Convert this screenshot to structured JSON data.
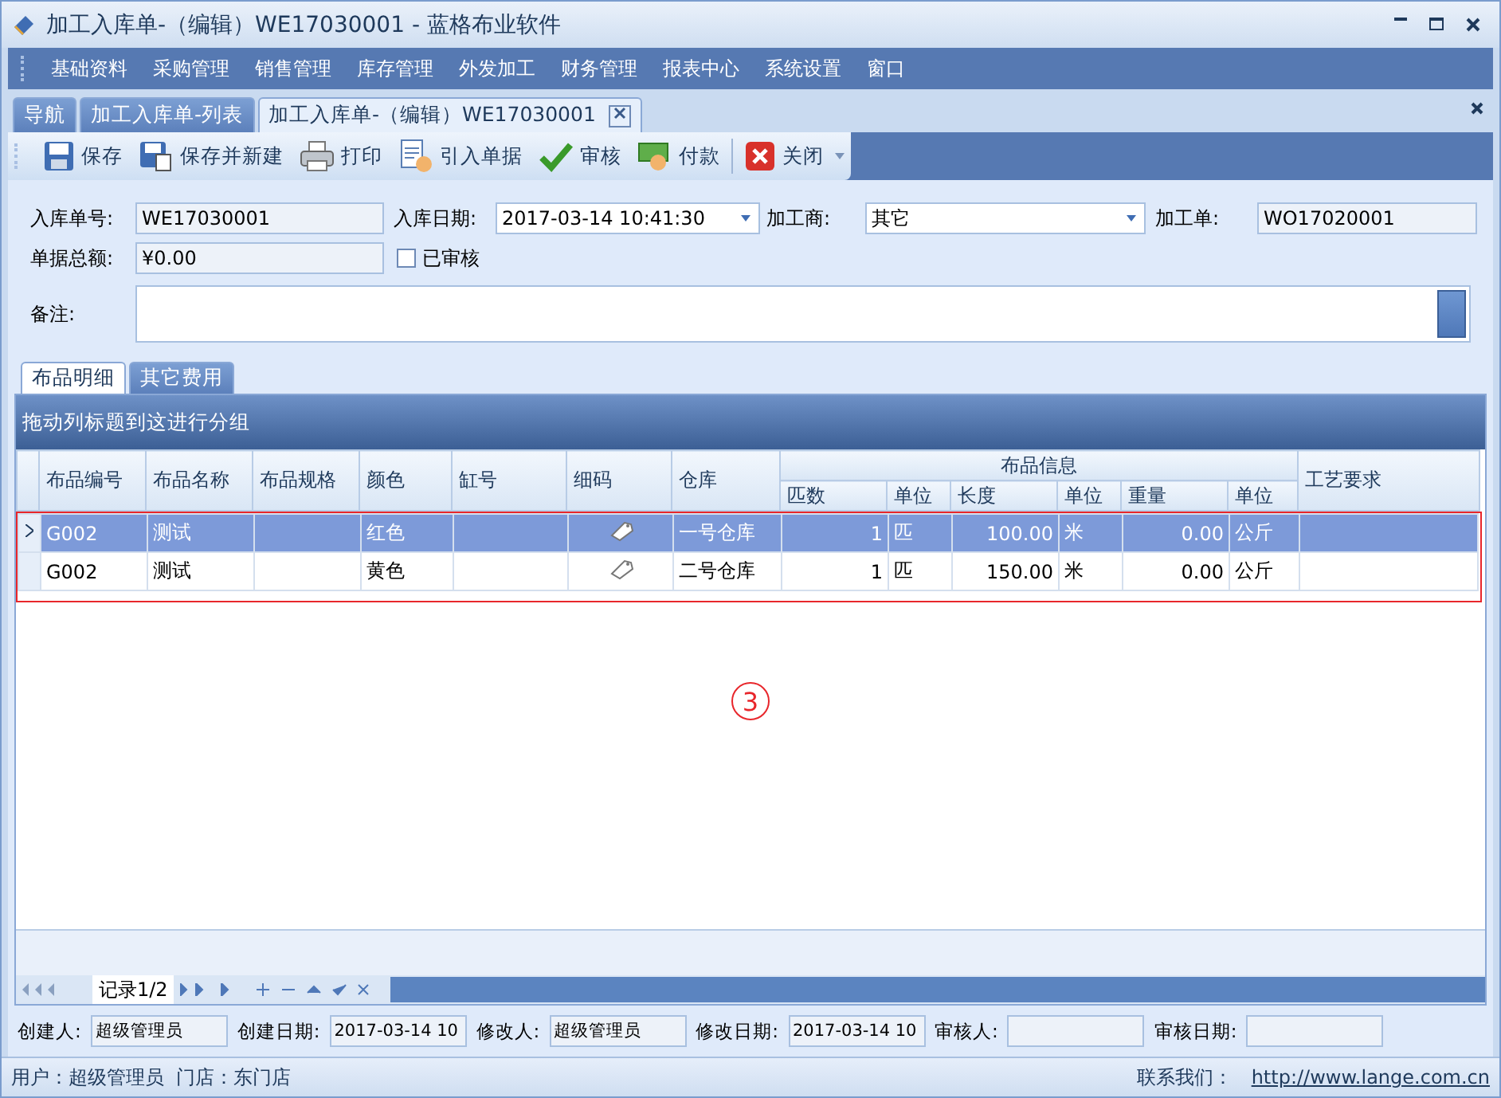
{
  "window": {
    "title": "加工入库单-（编辑）WE17030001 - 蓝格布业软件"
  },
  "menu": [
    "基础资料",
    "采购管理",
    "销售管理",
    "库存管理",
    "外发加工",
    "财务管理",
    "报表中心",
    "系统设置",
    "窗口"
  ],
  "doc_tabs": [
    {
      "label": "导航",
      "selected": false,
      "closable": false
    },
    {
      "label": "加工入库单-列表",
      "selected": false,
      "closable": false
    },
    {
      "label": "加工入库单-（编辑）WE17030001",
      "selected": true,
      "closable": true
    }
  ],
  "toolbar": [
    {
      "label": "保存",
      "kind": "save"
    },
    {
      "label": "保存并新建",
      "kind": "save-new"
    },
    {
      "label": "打印",
      "kind": "print"
    },
    {
      "label": "引入单据",
      "kind": "import"
    },
    {
      "label": "审核",
      "kind": "check"
    },
    {
      "label": "付款",
      "kind": "pay"
    },
    {
      "label": "关闭",
      "kind": "close"
    }
  ],
  "form": {
    "order_no": {
      "label": "入库单号:",
      "value": "WE17030001"
    },
    "date": {
      "label": "入库日期:",
      "value": "2017-03-14 10:41:30"
    },
    "processor": {
      "label": "加工商:",
      "value": "其它"
    },
    "process_order": {
      "label": "加工单:",
      "value": "WO17020001"
    },
    "total": {
      "label": "单据总额:",
      "value": "¥0.00"
    },
    "audited": {
      "label": "已审核",
      "checked": false
    },
    "remark": {
      "label": "备注:"
    }
  },
  "detail_tabs": [
    {
      "label": "布品明细",
      "selected": true
    },
    {
      "label": "其它费用",
      "selected": false
    }
  ],
  "grid": {
    "group_panel": "拖动列标题到这进行分组",
    "columns": [
      {
        "label": "布品编号",
        "kind": "text"
      },
      {
        "label": "布品名称",
        "kind": "text"
      },
      {
        "label": "布品规格",
        "kind": "text"
      },
      {
        "label": "颜色",
        "kind": "text"
      },
      {
        "label": "缸号",
        "kind": "text"
      },
      {
        "label": "细码",
        "kind": "icon"
      },
      {
        "label": "仓库",
        "kind": "text"
      }
    ],
    "group": {
      "label": "布品信息",
      "columns": [
        {
          "label": "匹数",
          "kind": "number"
        },
        {
          "label": "单位",
          "kind": "text"
        },
        {
          "label": "长度",
          "kind": "number"
        },
        {
          "label": "单位",
          "kind": "text"
        },
        {
          "label": "重量",
          "kind": "number"
        },
        {
          "label": "单位",
          "kind": "text"
        }
      ]
    },
    "last_column": {
      "label": "工艺要求"
    },
    "rows": [
      {
        "selected": true,
        "cells": [
          "G002",
          "测试",
          null,
          "红色",
          null,
          null,
          "一号仓库",
          "1",
          "匹",
          "100.00",
          "米",
          "0.00",
          "公斤",
          null
        ]
      },
      {
        "selected": false,
        "cells": [
          "G002",
          "测试",
          null,
          "黄色",
          null,
          null,
          "二号仓库",
          "1",
          "匹",
          "150.00",
          "米",
          "0.00",
          "公斤",
          null
        ]
      }
    ],
    "annotation": "3",
    "navigator": "记录1/2"
  },
  "footer": [
    {
      "label": "创建人:",
      "value": "超级管理员"
    },
    {
      "label": "创建日期:",
      "value": "2017-03-14 10"
    },
    {
      "label": "修改人:",
      "value": "超级管理员"
    },
    {
      "label": "修改日期:",
      "value": "2017-03-14 10"
    },
    {
      "label": "审核人:"
    },
    {
      "label": "审核日期:"
    }
  ],
  "status_bar": {
    "user": "用户：超级管理员  门店：东门店",
    "contact": "联系我们：",
    "link": "http://www.lange.com.cn"
  }
}
